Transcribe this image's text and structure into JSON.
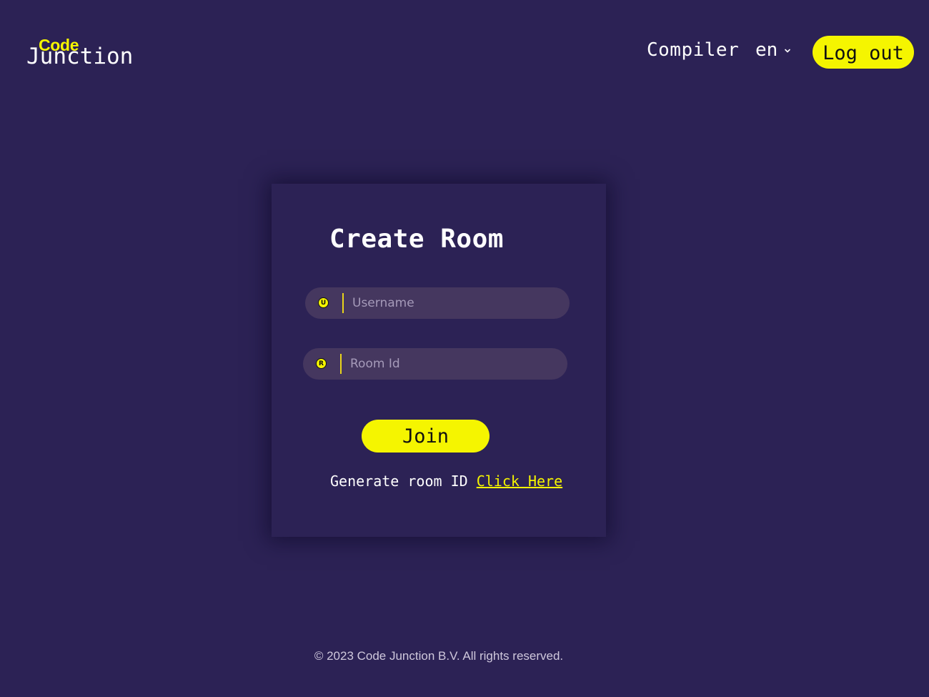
{
  "header": {
    "logo_top": "Code",
    "logo_bottom": "Junction",
    "nav_compiler": "Compiler",
    "language": "en",
    "logout_label": "Log out"
  },
  "card": {
    "title": "Create Room",
    "username_badge": "U",
    "username_placeholder": "Username",
    "room_badge": "R",
    "room_placeholder": "Room Id",
    "join_label": "Join",
    "generate_text": "Generate room ID",
    "generate_link": "Click Here"
  },
  "footer": {
    "copyright": "© 2023 Code Junction B.V. All rights reserved."
  },
  "colors": {
    "background": "#2c2255",
    "accent": "#f5f500",
    "field_bg": "#45375f"
  },
  "icons": {
    "language_dropdown": "chevron-down-icon"
  }
}
